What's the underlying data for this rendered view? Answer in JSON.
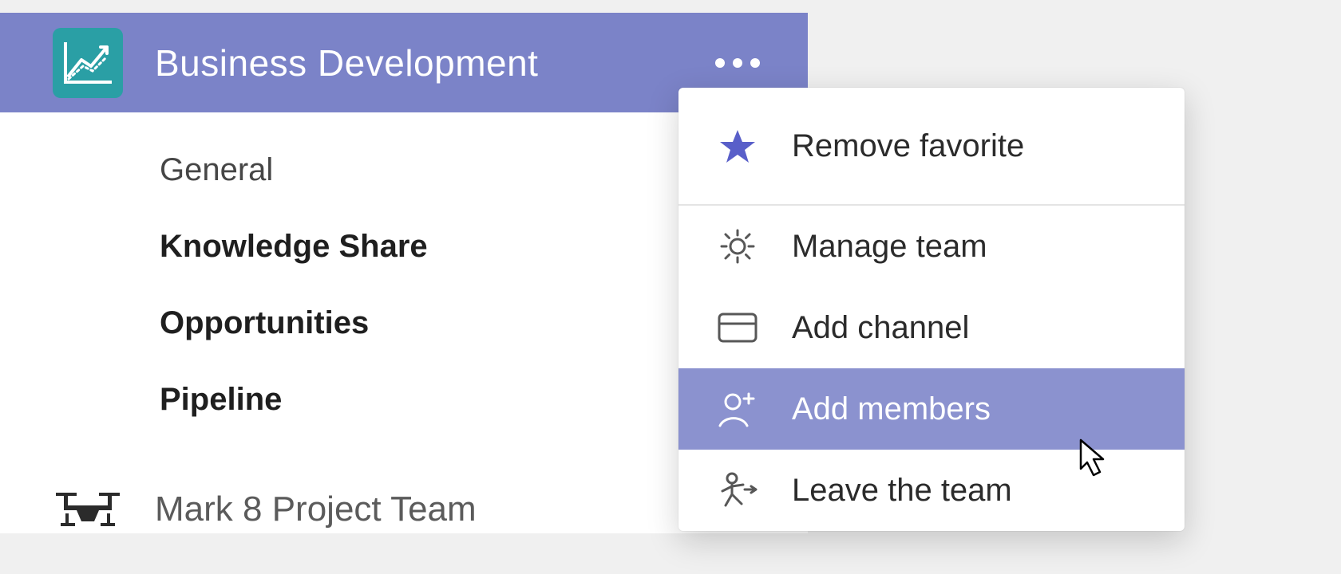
{
  "team": {
    "name": "Business Development",
    "icon": "chart-growth-icon"
  },
  "channels": [
    {
      "label": "General",
      "bold": false
    },
    {
      "label": "Knowledge Share",
      "bold": true
    },
    {
      "label": "Opportunities",
      "bold": true
    },
    {
      "label": "Pipeline",
      "bold": true
    }
  ],
  "second_team": {
    "name": "Mark 8 Project Team",
    "icon": "drone-icon"
  },
  "menu": {
    "items": [
      {
        "label": "Remove favorite",
        "icon": "star-icon",
        "hovered": false,
        "group": "top"
      },
      {
        "label": "Manage team",
        "icon": "gear-icon",
        "hovered": false,
        "group": "mid"
      },
      {
        "label": "Add channel",
        "icon": "card-icon",
        "hovered": false,
        "group": "mid"
      },
      {
        "label": "Add members",
        "icon": "add-person-icon",
        "hovered": true,
        "group": "mid"
      },
      {
        "label": "Leave the team",
        "icon": "leave-icon",
        "hovered": false,
        "group": "mid"
      }
    ]
  }
}
